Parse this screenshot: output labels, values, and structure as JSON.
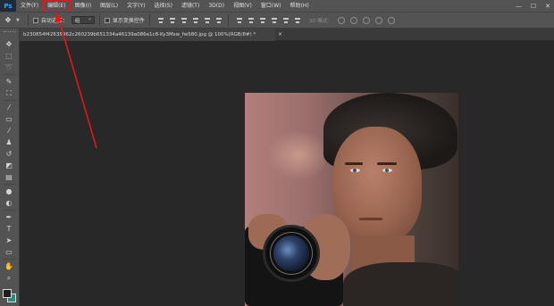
{
  "app": {
    "logo": "Ps"
  },
  "menu": [
    {
      "label": "文件(F)",
      "name": "menu-file"
    },
    {
      "label": "编辑(E)",
      "name": "menu-edit",
      "highlight": true
    },
    {
      "label": "图像(I)",
      "name": "menu-image"
    },
    {
      "label": "图层(L)",
      "name": "menu-layer"
    },
    {
      "label": "文字(Y)",
      "name": "menu-type"
    },
    {
      "label": "选择(S)",
      "name": "menu-select"
    },
    {
      "label": "滤镜(T)",
      "name": "menu-filter"
    },
    {
      "label": "3D(D)",
      "name": "menu-3d"
    },
    {
      "label": "视图(V)",
      "name": "menu-view"
    },
    {
      "label": "窗口(W)",
      "name": "menu-window"
    },
    {
      "label": "帮助(H)",
      "name": "menu-help"
    }
  ],
  "window_controls": {
    "minimize": "—",
    "maximize": "☐",
    "close": "✕"
  },
  "options": {
    "auto_select_label": "自动选择：",
    "auto_select_value": "组",
    "show_transform_label": "显示变换控件",
    "mode_3d_label": "3D 模式："
  },
  "document": {
    "tab_title": "b230854f42635962c260239b651334a46139a086e1c8-Ky3Msw_fw580.jpg @ 100%(RGB/8#) *",
    "close_symbol": "×"
  },
  "colors": {
    "highlight": "#e01818",
    "arrow": "#e01818",
    "foreground": "#1e1e1e",
    "background": "#2e8a7e"
  },
  "tools": [
    "move-tool-icon",
    "marquee-tool-icon",
    "lasso-tool-icon",
    "quick-select-tool-icon",
    "crop-tool-icon",
    "eyedropper-tool-icon",
    "healing-brush-tool-icon",
    "brush-tool-icon",
    "clone-stamp-tool-icon",
    "history-brush-tool-icon",
    "eraser-tool-icon",
    "gradient-tool-icon",
    "blur-tool-icon",
    "dodge-tool-icon",
    "pen-tool-icon",
    "type-tool-icon",
    "path-selection-tool-icon",
    "shape-tool-icon",
    "hand-tool-icon",
    "zoom-tool-icon"
  ]
}
